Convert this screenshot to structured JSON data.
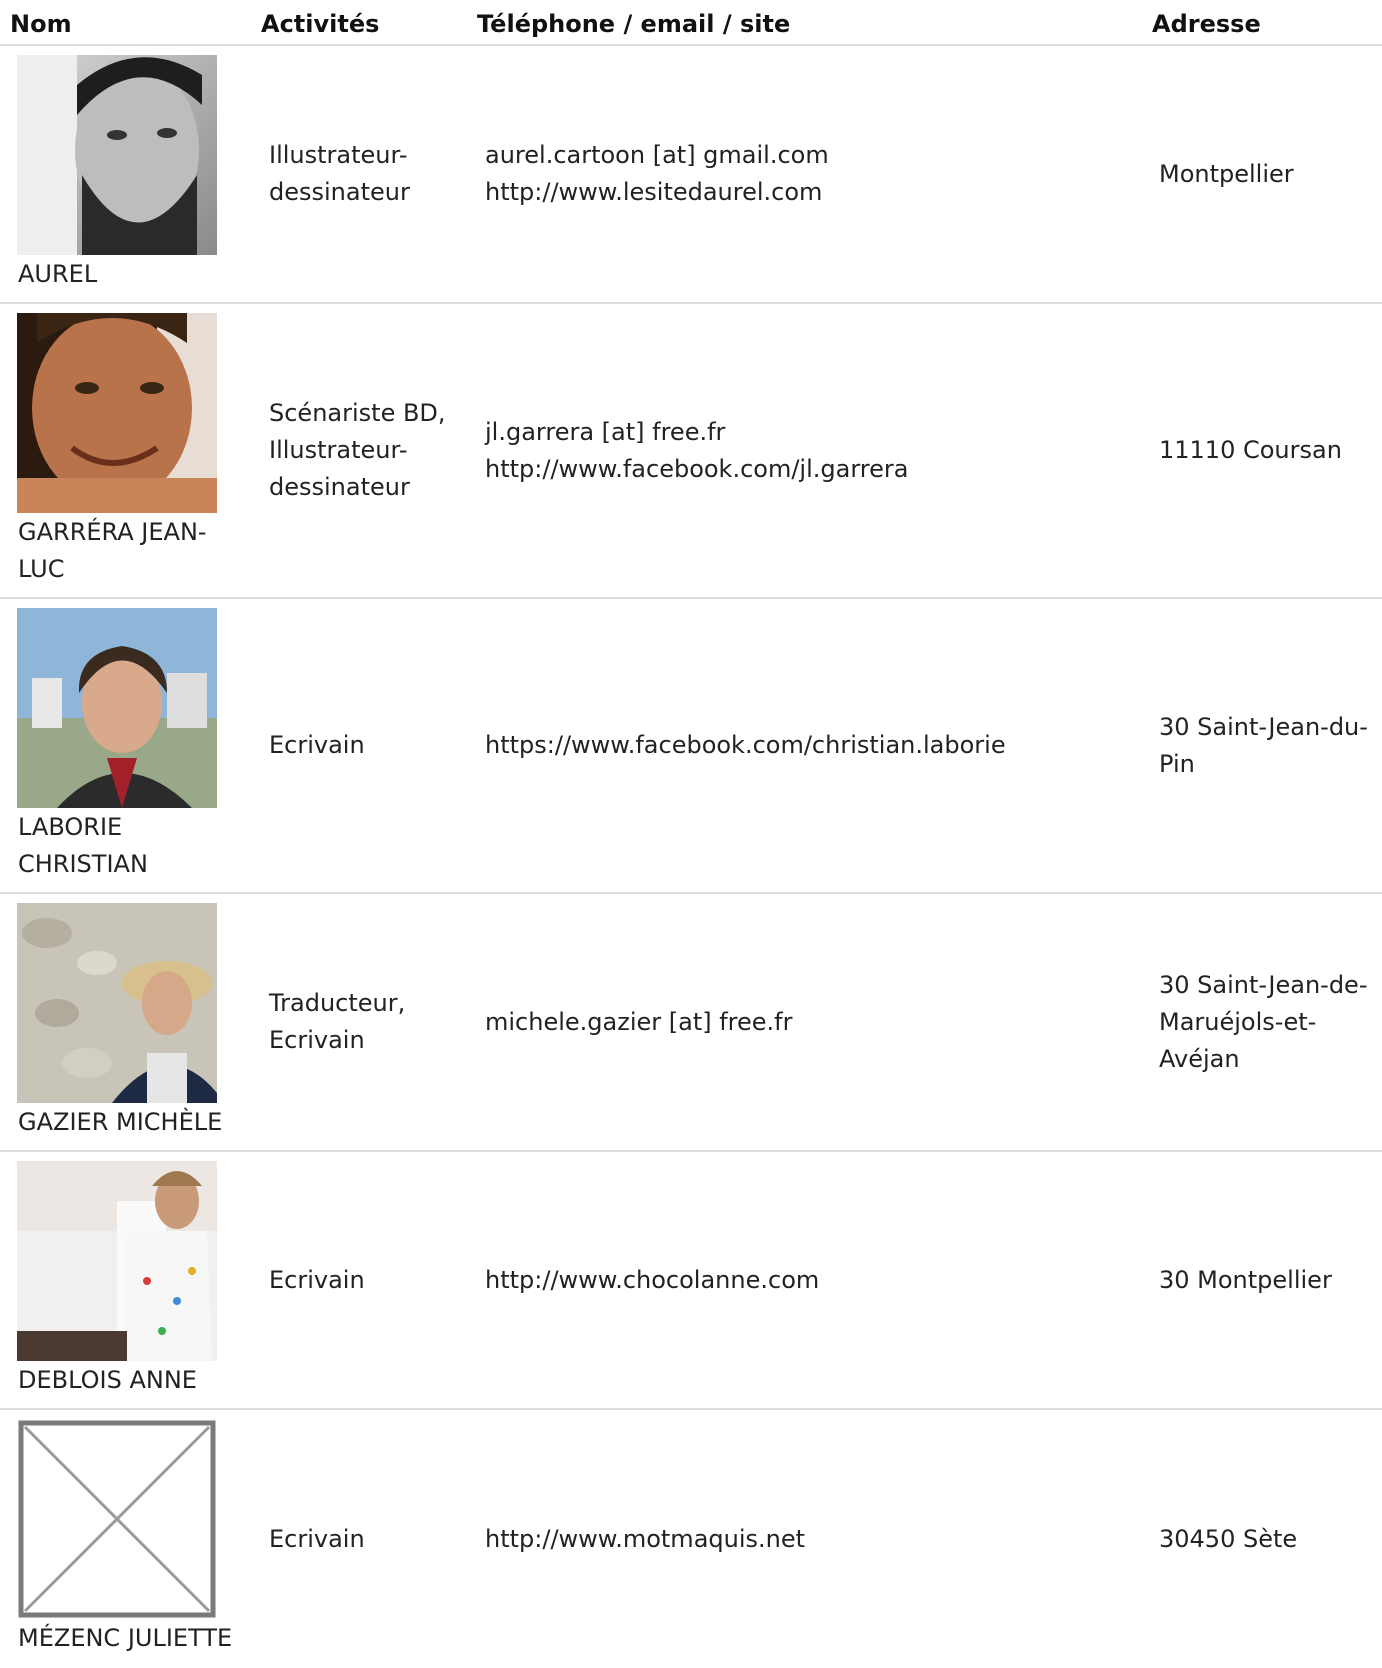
{
  "table": {
    "headers": {
      "name": "Nom",
      "activities": "Activités",
      "contact": "Téléphone / email / site",
      "address": "Adresse"
    },
    "rows": [
      {
        "name": "AUREL",
        "activities": "Illustrateur-\ndessinateur",
        "contact": "aurel.cartoon [at] gmail.com\nhttp://www.lesitedaurel.com",
        "address": "Montpellier"
      },
      {
        "name": "GARRÉRA JEAN-\nLUC",
        "activities": "Scénariste BD,\nIllustrateur-\ndessinateur",
        "contact": "jl.garrera [at] free.fr\nhttp://www.facebook.com/jl.garrera",
        "address": "11110 Coursan"
      },
      {
        "name": "LABORIE\nCHRISTIAN",
        "activities": "Ecrivain",
        "contact": "https://www.facebook.com/christian.laborie",
        "address": "30 Saint-Jean-du-\nPin"
      },
      {
        "name": "GAZIER MICHÈLE",
        "activities": "Traducteur,\nEcrivain",
        "contact": "michele.gazier [at] free.fr",
        "address": "30 Saint-Jean-de-\nMaruéjols-et-\nAvéjan"
      },
      {
        "name": "DEBLOIS ANNE",
        "activities": "Ecrivain",
        "contact": "http://www.chocolanne.com",
        "address": "30 Montpellier"
      },
      {
        "name": "MÉZENC JULIETTE",
        "activities": "Ecrivain",
        "contact": "http://www.motmaquis.net",
        "address": "30450 Sète"
      }
    ]
  },
  "colors": {
    "header_text": "#111111",
    "body_text": "#222222",
    "divider": "#dcdcdc"
  }
}
